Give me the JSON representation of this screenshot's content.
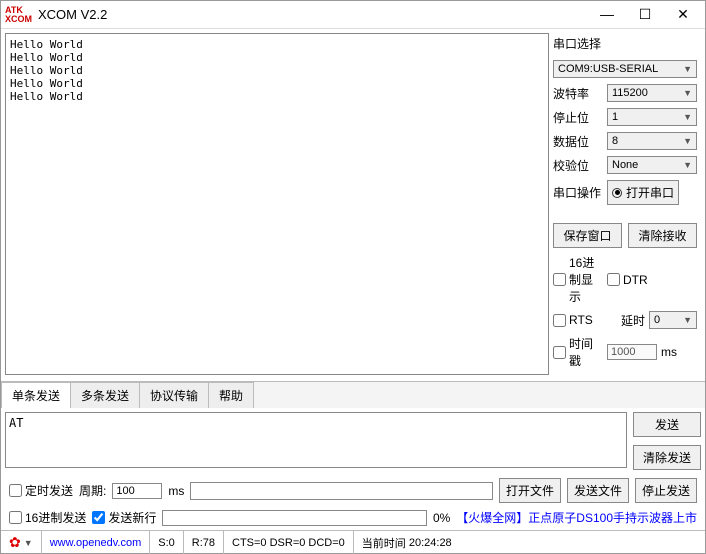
{
  "title": "XCOM V2.2",
  "logo": "ATK\nXCOM",
  "rx_content": "Hello World\nHello World\nHello World\nHello World\nHello World",
  "side": {
    "port_label": "串口选择",
    "port_value": "COM9:USB-SERIAL",
    "baud_label": "波特率",
    "baud_value": "115200",
    "stop_label": "停止位",
    "stop_value": "1",
    "data_label": "数据位",
    "data_value": "8",
    "parity_label": "校验位",
    "parity_value": "None",
    "op_label": "串口操作",
    "open_btn": "打开串口",
    "save_btn": "保存窗口",
    "clear_rx_btn": "清除接收",
    "hex_disp": "16进制显示",
    "dtr": "DTR",
    "rts": "RTS",
    "delay_label": "延时",
    "delay_value": "0",
    "timestamp": "时间戳",
    "ts_value": "1000",
    "ts_unit": "ms"
  },
  "tabs": {
    "single": "单条发送",
    "multi": "多条发送",
    "proto": "协议传输",
    "help": "帮助"
  },
  "tx_content": "AT",
  "send_btn": "发送",
  "clear_tx_btn": "清除发送",
  "bottom": {
    "timed_send": "定时发送",
    "period_label": "周期:",
    "period_value": "100",
    "period_unit": "ms",
    "open_file": "打开文件",
    "send_file": "发送文件",
    "stop_send": "停止发送",
    "hex_send": "16进制发送",
    "send_newline": "发送新行",
    "progress": "0%",
    "promo": "【火爆全网】正点原子DS100手持示波器上市"
  },
  "status": {
    "url": "www.openedv.com",
    "s": "S:0",
    "r": "R:78",
    "cts": "CTS=0 DSR=0 DCD=0",
    "time_label": "当前时间",
    "time_value": "20:24:28"
  }
}
